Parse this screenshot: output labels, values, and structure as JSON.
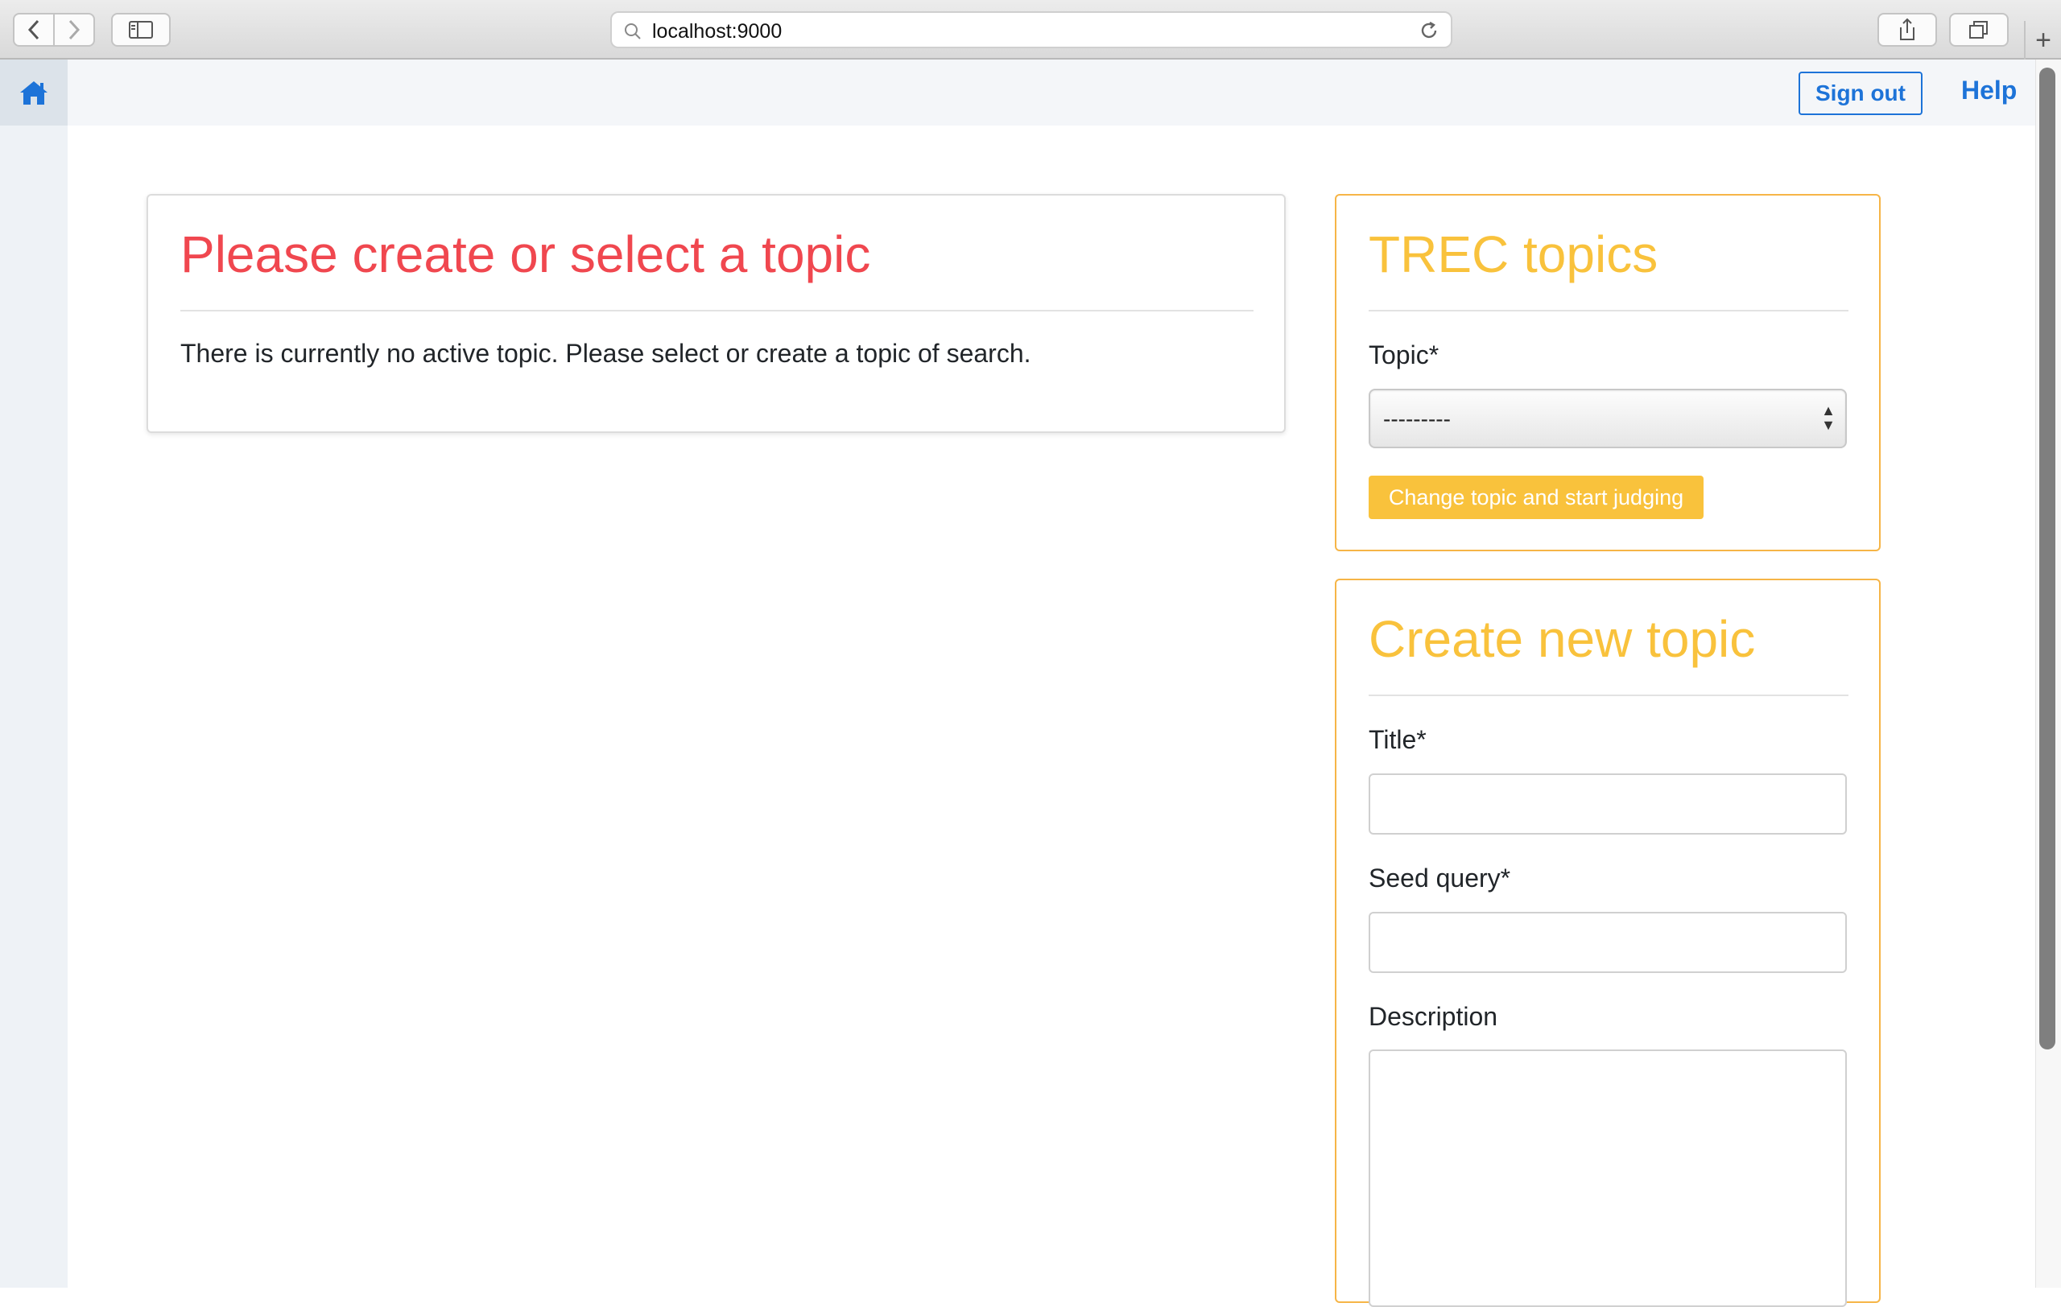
{
  "browser": {
    "url": "localhost:9000",
    "back_icon": "chevron-left-icon",
    "forward_icon": "chevron-right-icon",
    "sidebar_icon": "sidebar-icon",
    "share_icon": "share-icon",
    "tabs_icon": "tabs-icon",
    "new_tab_label": "+"
  },
  "nav": {
    "home_icon": "home-icon",
    "sign_out": "Sign out",
    "help": "Help",
    "accent_color": "#1d73d8"
  },
  "main_card": {
    "title": "Please create or select a topic",
    "message": "There is currently no active topic. Please select or create a topic of search.",
    "title_color": "#f0474f"
  },
  "trec_card": {
    "title": "TREC topics",
    "topic_label": "Topic*",
    "topic_selected": "---------",
    "submit": "Change topic and start judging",
    "accent_color": "#f9c23c"
  },
  "new_topic_card": {
    "title": "Create new topic",
    "title_label": "Title*",
    "title_value": "",
    "seed_query_label": "Seed query*",
    "seed_query_value": "",
    "description_label": "Description",
    "description_value": ""
  }
}
